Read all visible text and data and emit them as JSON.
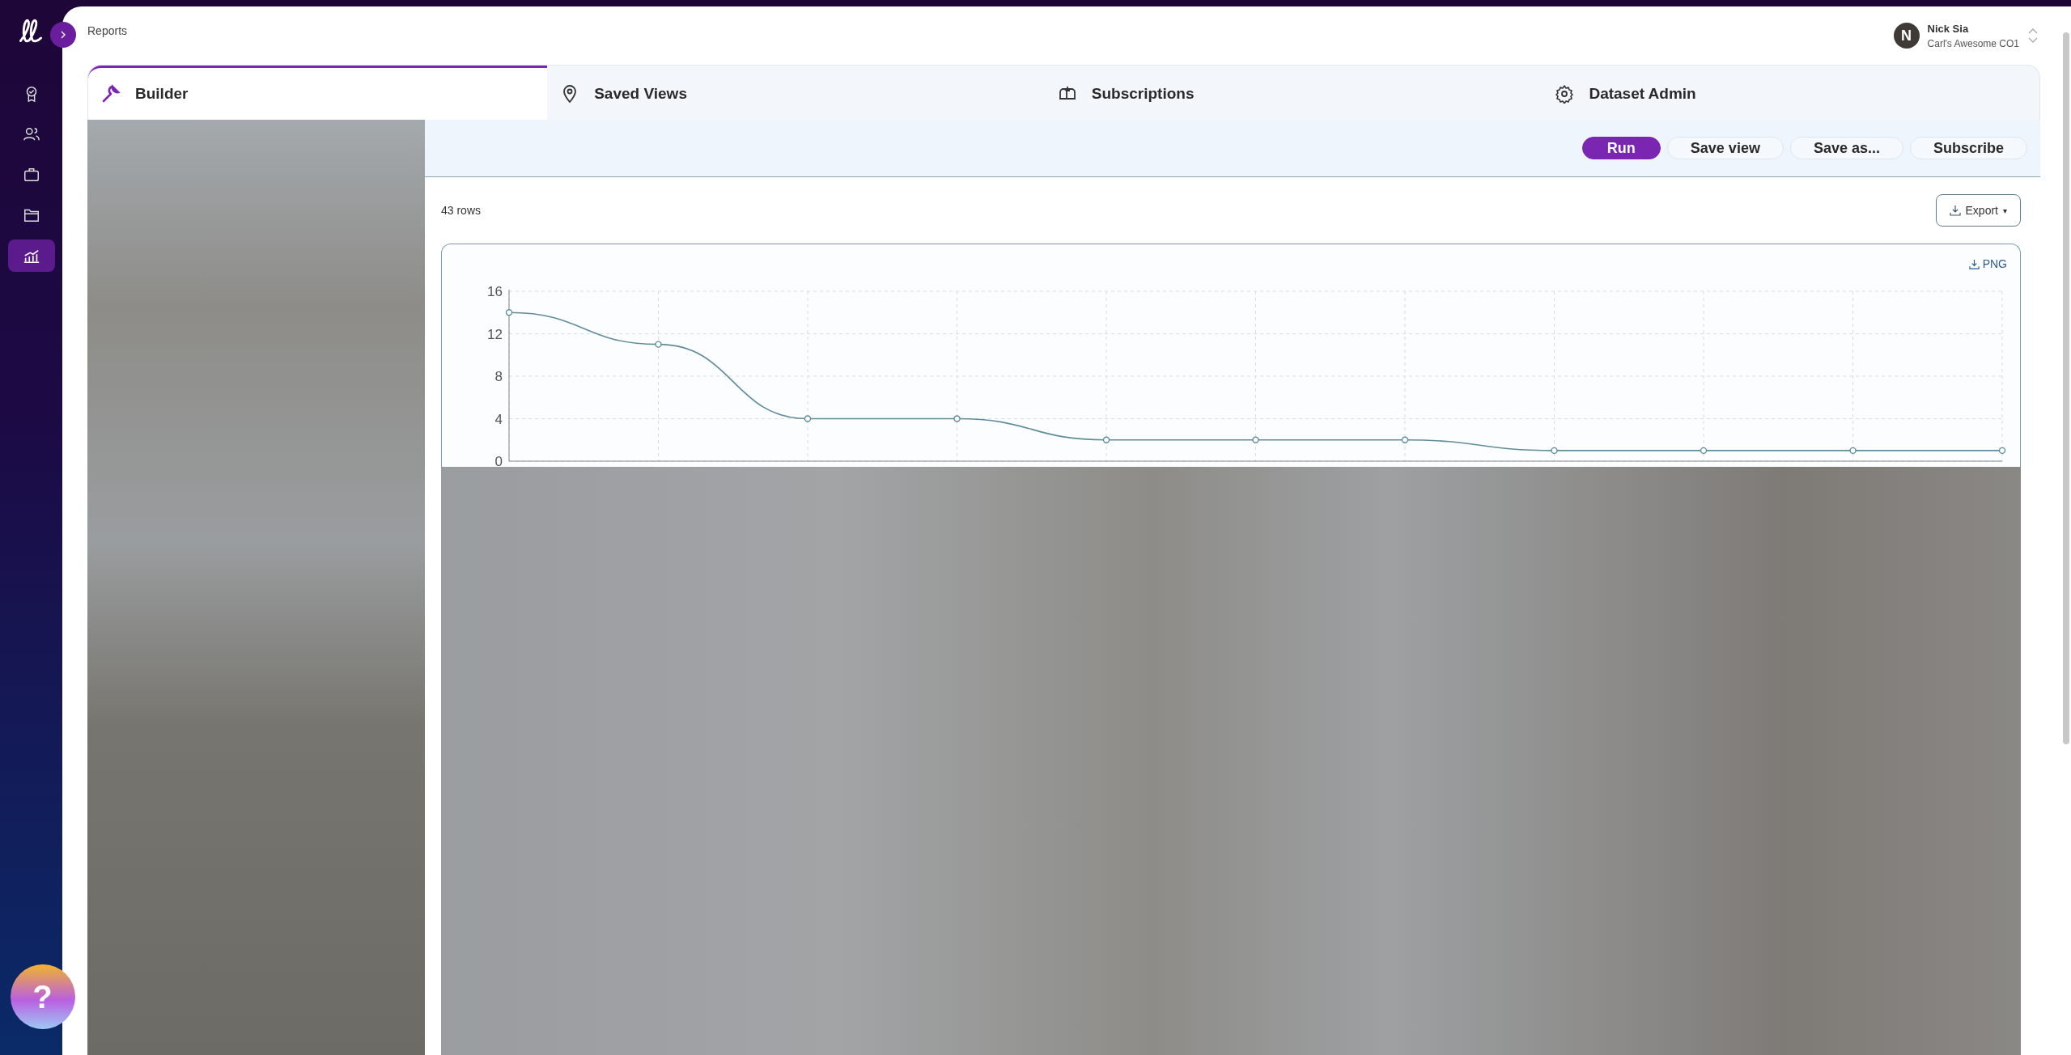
{
  "sidebar": {
    "items": [
      {
        "kind": "award",
        "selected": false
      },
      {
        "kind": "users",
        "selected": false
      },
      {
        "kind": "briefcase",
        "selected": false
      },
      {
        "kind": "folder",
        "selected": false
      },
      {
        "kind": "chart",
        "selected": true
      }
    ]
  },
  "breadcrumb": "Reports",
  "user": {
    "initial": "N",
    "name": "Nick Sia",
    "org": "Carl's Awesome CO1"
  },
  "tabs": [
    {
      "label": "Builder",
      "kind": "wrench",
      "selected": true
    },
    {
      "label": "Saved Views",
      "kind": "pin",
      "selected": false
    },
    {
      "label": "Subscriptions",
      "kind": "mailbox",
      "selected": false
    },
    {
      "label": "Dataset Admin",
      "kind": "gear",
      "selected": false
    }
  ],
  "actions": [
    {
      "label": "Run",
      "kind": "primary"
    },
    {
      "label": "Save view",
      "kind": "secondary"
    },
    {
      "label": "Save as...",
      "kind": "secondary"
    },
    {
      "label": "Subscribe",
      "kind": "secondary"
    }
  ],
  "row_count": "43 rows",
  "export": {
    "label": "Export",
    "caret": "▾"
  },
  "chart": {
    "download_label": "PNG",
    "chart_data": {
      "type": "line",
      "grid": true,
      "ylim": [
        0,
        16
      ],
      "yticks": [
        0,
        4,
        8,
        12,
        16
      ],
      "series": [
        {
          "color": "#5f8d9c",
          "marker": "circle",
          "values": [
            14,
            11,
            4,
            4,
            2,
            2,
            2,
            1,
            1,
            1,
            1
          ]
        }
      ]
    }
  },
  "help": {
    "label": "?"
  }
}
